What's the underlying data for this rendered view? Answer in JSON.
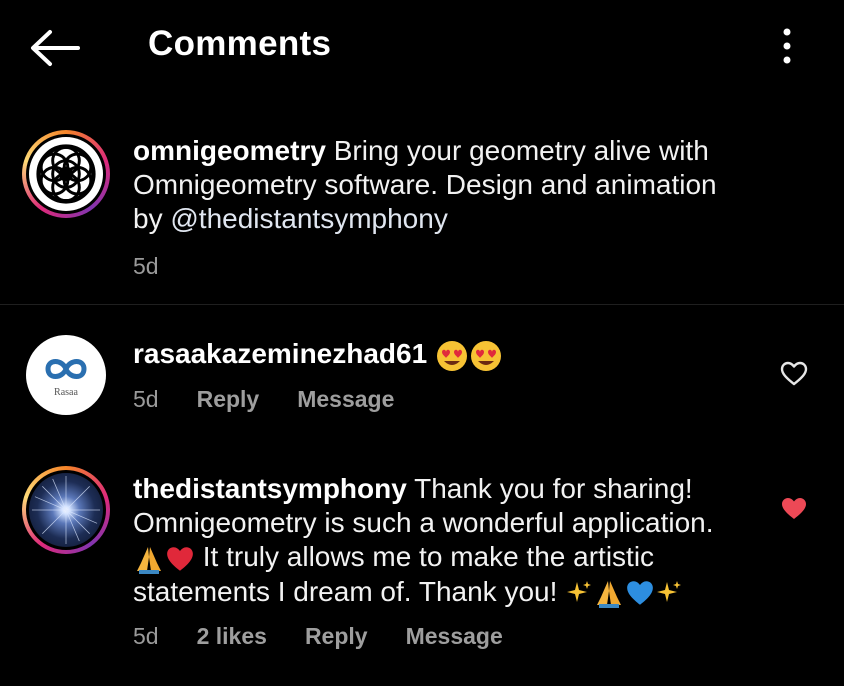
{
  "header": {
    "title": "Comments",
    "back_icon": "arrow-left-icon",
    "more_icon": "vertical-dots-icon"
  },
  "post": {
    "username": "omnigeometry",
    "caption_line1": "Bring your geometry alive with",
    "caption_line2": "Omnigeometry software. Design and animation",
    "caption_line3_prefix": "by ",
    "mention": "@thedistantsymphony",
    "time": "5d"
  },
  "comments": [
    {
      "username": "rasaakazeminezhad61",
      "emojis": [
        "heart-eyes-emoji",
        "heart-eyes-emoji"
      ],
      "avatar_label": "Rasaa",
      "time": "5d",
      "reply_label": "Reply",
      "message_label": "Message",
      "liked": false,
      "like_icon": "heart-outline-icon"
    },
    {
      "username": "thedistantsymphony",
      "line1": "Thank you for sharing!",
      "line2": "Omnigeometry is such a wonderful application.",
      "line3": "It truly allows me to make the artistic",
      "line4": "statements I dream of. Thank you!",
      "time": "5d",
      "likes": "2 likes",
      "reply_label": "Reply",
      "message_label": "Message",
      "liked": true,
      "like_icon": "heart-filled-icon"
    }
  ],
  "colors": {
    "background": "#000000",
    "text": "#f2f2f2",
    "meta": "#9a9a9a",
    "like_red": "#ed4956"
  }
}
